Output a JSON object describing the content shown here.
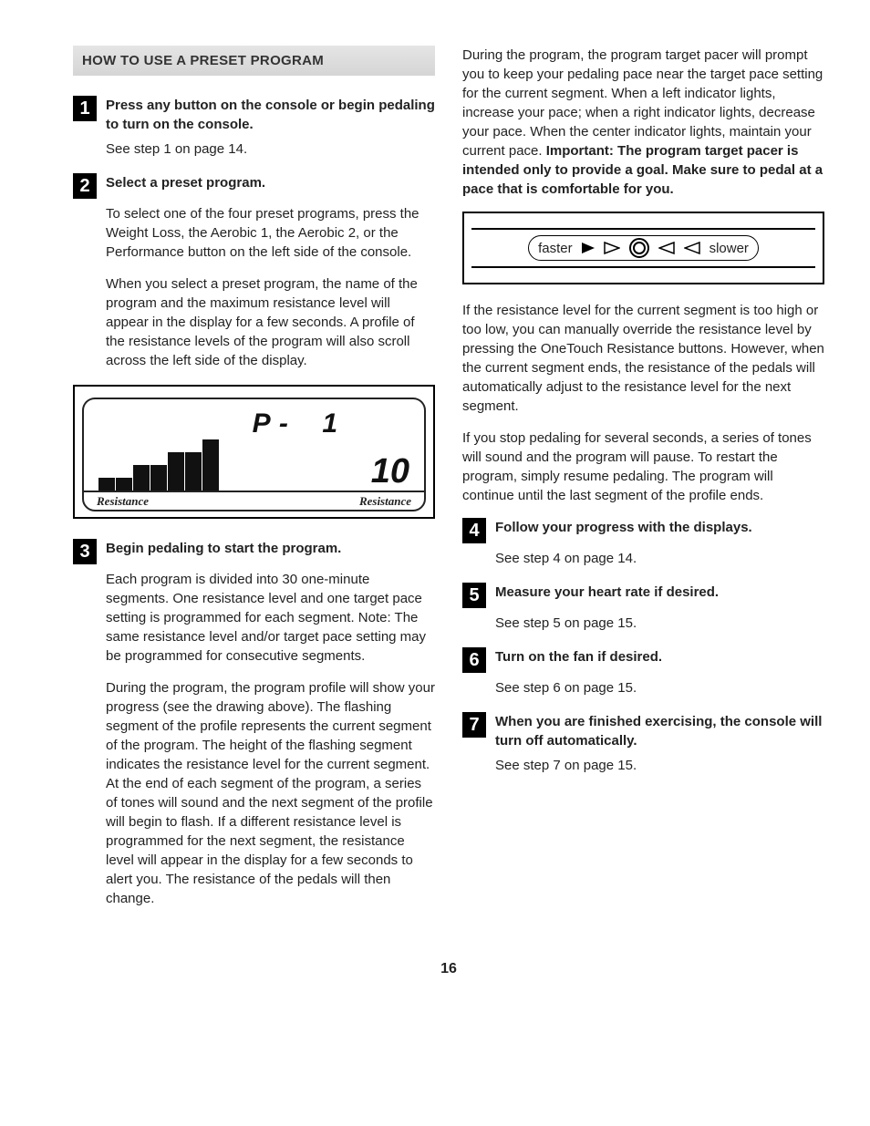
{
  "sectionHeader": "HOW TO USE A PRESET PROGRAM",
  "steps": {
    "s1": {
      "num": "1",
      "title": "Press any button on the console or begin pedaling to turn on the console.",
      "body1": "See step 1 on page 14."
    },
    "s2": {
      "num": "2",
      "title": "Select a preset program.",
      "body1": "To select one of the four preset programs, press the Weight Loss, the Aerobic 1, the Aerobic 2, or the Performance button on the left side of the console.",
      "body2": "When you select a preset program, the name of the program and the maximum resistance level will appear in the display for a few seconds. A profile of the resistance levels of the program will also scroll across the left side of the display."
    },
    "s3": {
      "num": "3",
      "title": "Begin pedaling to start the program.",
      "body1": "Each program is divided into 30 one-minute segments. One resistance level and one target pace setting is programmed for each segment. Note: The same resistance level and/or target pace setting may be programmed for consecutive segments.",
      "body2": "During the program, the program profile will show your progress (see the drawing above). The flashing segment of the profile represents the current segment of the program. The height of the flashing segment indicates the resistance level for the current segment. At the end of each segment of the program, a series of tones will sound and the next segment of the profile will begin to flash. If a different resistance level is programmed for the next segment, the resistance level will appear in the display for a few seconds to alert you. The resistance of the pedals will then change."
    },
    "s4": {
      "num": "4",
      "title": "Follow your progress with the displays.",
      "body1": "See step 4 on page 14."
    },
    "s5": {
      "num": "5",
      "title": "Measure your heart rate if desired.",
      "body1": "See step 5 on page 15."
    },
    "s6": {
      "num": "6",
      "title": "Turn on the fan if desired.",
      "body1": "See step 6 on page 15."
    },
    "s7": {
      "num": "7",
      "title": "When you are finished exercising, the console will turn off automatically.",
      "body1": "See step 7 on page 15."
    }
  },
  "rightCol": {
    "p1a": "During the program, the program target pacer will prompt you to keep your pedaling pace near the target pace setting for the current segment. When a left indicator lights, increase your pace; when a right indicator lights, decrease your pace. When the center indicator lights, maintain your current pace. ",
    "p1b": "Important: The program target pacer is intended only to provide a goal. Make sure to pedal at a pace that is comfortable for you.",
    "p2": "If the resistance level for the current segment is too high or too low, you can manually override the resistance level by pressing the OneTouch Resistance buttons. However, when the current segment ends, the resistance of the pedals will automatically adjust to the resistance level for the next segment.",
    "p3": "If you stop pedaling for several seconds, a series of tones will sound and the program will pause. To restart the program, simply resume pedaling. The program will continue until the last segment of the profile ends."
  },
  "display": {
    "p": "P -",
    "one": "1",
    "ten": "10",
    "resistance": "Resistance"
  },
  "pacer": {
    "faster": "faster",
    "slower": "slower"
  },
  "pageNum": "16"
}
